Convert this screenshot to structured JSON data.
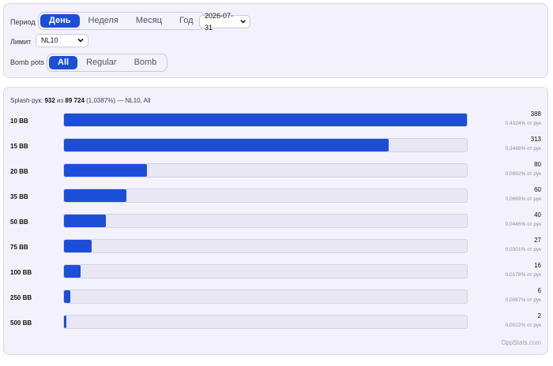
{
  "filters": {
    "period_label": "Период",
    "period_options": [
      "День",
      "Неделя",
      "Месяц",
      "Год"
    ],
    "period_selected": 0,
    "date_value": "2026-07-31",
    "limit_label": "Лимит",
    "limit_value": "NL10",
    "bomb_label": "Bomb pots",
    "bomb_options": [
      "All",
      "Regular",
      "Bomb"
    ],
    "bomb_selected": 0
  },
  "summary": {
    "prefix": "Splash-рук:",
    "splash": "932",
    "of_word": "из",
    "total": "89 724",
    "percent": "(1,0387%)",
    "suffix": "— NL10, All"
  },
  "colors": {
    "accent": "#1d4ed8",
    "card_bg": "#f3f2fb",
    "track_bg": "#e8e7f3"
  },
  "chart_data": {
    "type": "bar",
    "orientation": "horizontal",
    "categories": [
      "10 BB",
      "15 BB",
      "20 BB",
      "35 BB",
      "50 BB",
      "75 BB",
      "100 BB",
      "250 BB",
      "500 BB"
    ],
    "values": [
      388,
      313,
      80,
      60,
      40,
      27,
      16,
      6,
      2
    ],
    "percents": [
      "0,4324% от рук",
      "0,3488% от рук",
      "0,0892% от рук",
      "0,0669% от рук",
      "0,0446% от рук",
      "0,0301% от рук",
      "0,0178% от рук",
      "0,0067% от рук",
      "0,0022% от рук"
    ],
    "max": 388
  },
  "watermark": "OppStats.com"
}
